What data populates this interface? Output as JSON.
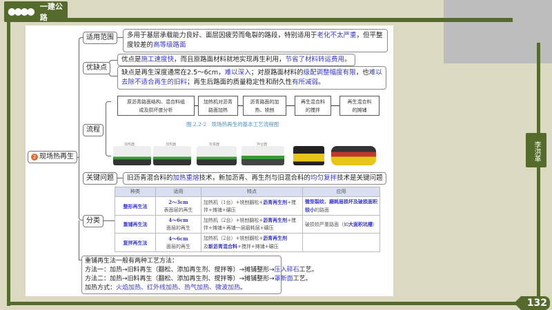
{
  "header": {
    "title": "一建公路",
    "icon": "people-icon"
  },
  "author": "李洪革",
  "page_number": "132",
  "central_node": {
    "badge": "2",
    "label": "现场热再生"
  },
  "branches": {
    "scope": {
      "label": "适用范围",
      "t1": "多用于基层承载能力良好、面层因疲劳而龟裂的路段，特别适用于",
      "h1": "老化不太严重",
      "t2": "，但平整度较差的",
      "h2": "高等级路面"
    },
    "pros_cons": {
      "label": "优缺点",
      "pro": {
        "t1": "优点是",
        "h1": "施工速度快",
        "t2": "，而且原路面材料就地实现再生利用，",
        "h2": "节省了材料转运费用",
        "t3": "。"
      },
      "con": {
        "t1": "缺点是再生深度通常在2.5～6cm，",
        "h1": "难以深入",
        "t2": "；对原路面材料的",
        "h2": "级配调整幅度有限",
        "t3": "，也",
        "h3": "难以去除不适合再生的旧料",
        "t4": "；再生后路面的质量稳定性和耐久性",
        "h4": "有所减弱",
        "t5": "。"
      }
    },
    "process": {
      "label": "流程",
      "steps": [
        "原沥青路面结构、混合料组成及损坏度分析",
        "加热机对沥青路面加热",
        "沥青路面的加热、铣刨",
        "再生混合料的搅拌",
        "再生混合料的摊铺"
      ],
      "caption": "图 2.2-2　现场热再生的基本工艺流程图",
      "machines": [
        "加热器",
        "加热器",
        "松铣器",
        "拌合器"
      ]
    },
    "key_issue": {
      "label": "关键问题",
      "t1": "旧沥青混合料的",
      "h1": "加热重熔",
      "t2": "技术，新加沥青、再生剂与旧混合料的",
      "h2": "均匀复拌",
      "t3": "技术是关键问题"
    },
    "classification": {
      "label": "分类",
      "headers": [
        "种类",
        "适用",
        "特点",
        "应用"
      ],
      "rows": [
        {
          "name": "整形再生法",
          "depth": "2～3cm",
          "layer": "表面层的再生",
          "f1": "加热机（1台）+铣刨翻松+",
          "fh": "沥青再生剂",
          "f2": "+搅拌+摊铺+碾压",
          "app_h": "微型裂纹、磨耗层损坏及破损面积较小",
          "app_t": "的路面"
        },
        {
          "name": "重铺再生法",
          "depth": "4～6cm",
          "layer": "面层的再生",
          "f1": "加热机（2台）+铣刨翻松+",
          "fh": "沥青再生剂",
          "f2": "+搅拌+摊铺+再铺一层磨耗层+碾压",
          "app_t": "破损较严重路面（如",
          "app_h": "大面积坑槽",
          "app_t2": "）"
        },
        {
          "name": "复拌再生法",
          "depth": "4～6cm",
          "layer": "面层的再生",
          "f1": "加热机（2台）+铣刨翻松+",
          "fh": "沥青再生剂",
          "f1b": "及",
          "fh2": "新沥青混合料",
          "f2": "+搅拌+摊铺+碾压"
        }
      ]
    }
  },
  "note": {
    "l1": "重铺再生法一般有两种工艺方法：",
    "l2": "方法一：加热→旧料再生（翻松、添加再生剂、搅拌等）→摊铺整形→",
    "l2h": "压入碎石",
    "l2e": "工艺。",
    "l3": "方法二：加热→旧料再生（翻松、添加再生剂、搅拌等）→摊铺整形→",
    "l3h": "罩新面",
    "l3e": "工艺。",
    "l4": "加热方式：",
    "l4h": "火焰加热、红外线加热、热气加热、微波加热",
    "l4e": "。"
  },
  "colors": {
    "frame": "#556b2b",
    "highlight": "#3535d6",
    "background": "#dcd9c3"
  }
}
